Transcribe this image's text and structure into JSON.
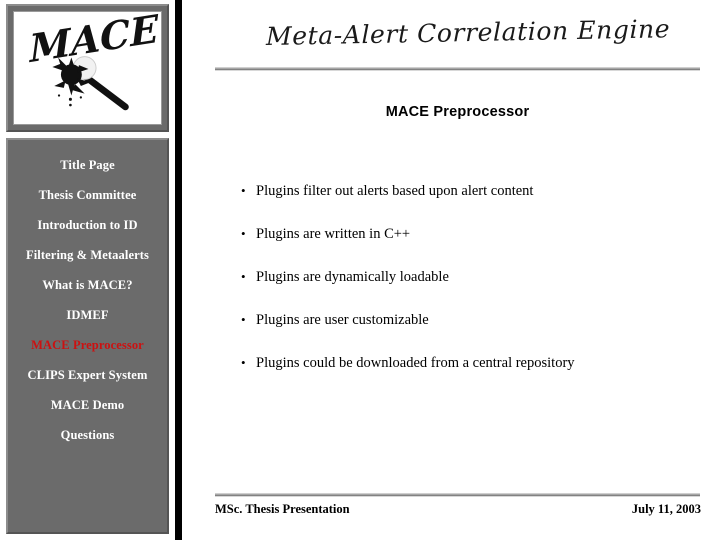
{
  "slide": {
    "header_script": "Meta-Alert Correlation Engine",
    "title": "MACE Preprocessor",
    "logo_wordmark": "MACE",
    "logo_icon": "mace-weapon-icon"
  },
  "sidebar": {
    "items": [
      {
        "label": "Title Page",
        "active": false
      },
      {
        "label": "Thesis Committee",
        "active": false
      },
      {
        "label": "Introduction to ID",
        "active": false
      },
      {
        "label": "Filtering & Metaalerts",
        "active": false
      },
      {
        "label": "What is MACE?",
        "active": false
      },
      {
        "label": "IDMEF",
        "active": false
      },
      {
        "label": "MACE Preprocessor",
        "active": true
      },
      {
        "label": "CLIPS Expert System",
        "active": false
      },
      {
        "label": "MACE Demo",
        "active": false
      },
      {
        "label": "Questions",
        "active": false
      }
    ],
    "active_color": "#cc1111",
    "text_color": "#ffffff",
    "background_color": "#6b6b6b"
  },
  "content": {
    "bullet_marker": "•",
    "bullets": [
      "Plugins filter out alerts based upon alert content",
      "Plugins are written in C++",
      "Plugins are dynamically loadable",
      "Plugins are user customizable",
      "Plugins could be downloaded from a central repository"
    ]
  },
  "footer": {
    "left": "MSc. Thesis Presentation",
    "right": "July 11, 2003"
  }
}
